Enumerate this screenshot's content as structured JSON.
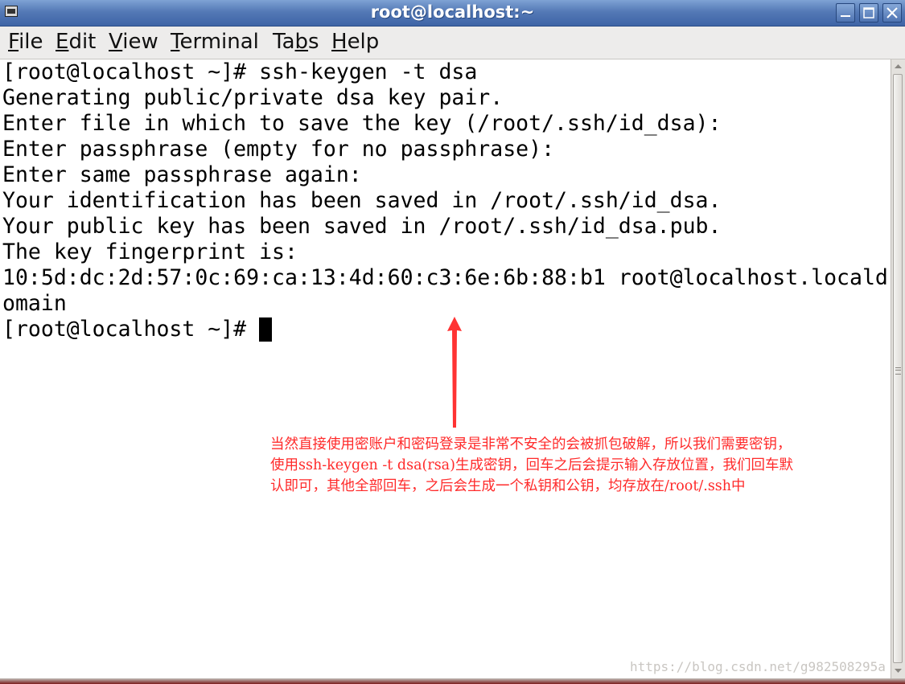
{
  "window": {
    "title": "root@localhost:~"
  },
  "menu": [
    {
      "mnemonic": "F",
      "rest": "ile"
    },
    {
      "pre": "",
      "mnemonic": "E",
      "rest": "dit"
    },
    {
      "mnemonic": "V",
      "rest": "iew"
    },
    {
      "mnemonic": "T",
      "rest": "erminal"
    },
    {
      "pre": "Ta",
      "mnemonic": "b",
      "rest": "s"
    },
    {
      "mnemonic": "H",
      "rest": "elp"
    }
  ],
  "terminal": {
    "lines": [
      "[root@localhost ~]# ssh-keygen -t dsa",
      "Generating public/private dsa key pair.",
      "Enter file in which to save the key (/root/.ssh/id_dsa):",
      "Enter passphrase (empty for no passphrase):",
      "Enter same passphrase again:",
      "Your identification has been saved in /root/.ssh/id_dsa.",
      "Your public key has been saved in /root/.ssh/id_dsa.pub.",
      "The key fingerprint is:",
      "10:5d:dc:2d:57:0c:69:ca:13:4d:60:c3:6e:6b:88:b1 root@localhost.locald",
      "omain",
      "[root@localhost ~]# "
    ]
  },
  "annotation": {
    "lines": [
      "当然直接使用密账户和密码登录是非常不安全的会被抓包破解，所以我们需要密钥，",
      "使用ssh-keygen -t dsa(rsa)生成密钥，回车之后会提示输入存放位置，我们回车默",
      "认即可，其他全部回车，之后会生成一个私钥和公钥，均存放在/root/.ssh中"
    ],
    "color": "#ff2a2a"
  },
  "watermark": "https://blog.csdn.net/g982508295a",
  "colors": {
    "titlebar": "#5479b6",
    "menubar": "#edeceb",
    "terminal_bg": "#ffffff",
    "terminal_fg": "#000000"
  }
}
